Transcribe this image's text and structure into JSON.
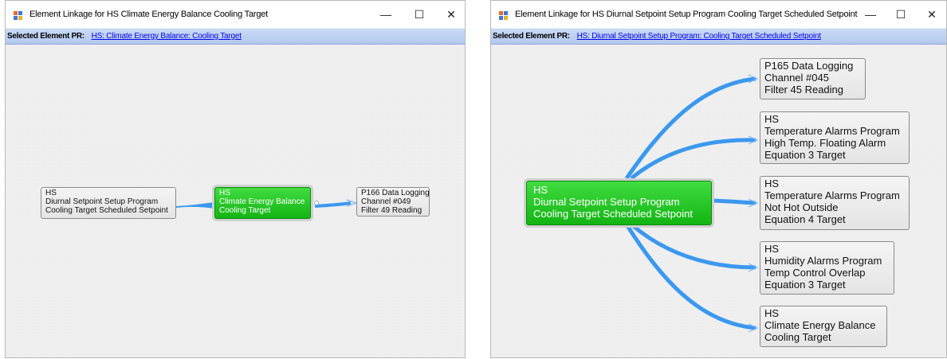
{
  "window1": {
    "title": "Element Linkage for HS Climate Energy Balance Cooling Target",
    "selected_label": "Selected Element PR:",
    "selected_link": "HS: Climate Energy Balance: Cooling Target",
    "controls": {
      "minimize": "—",
      "maximize": "☐",
      "close": "✕"
    },
    "nodes": {
      "source": [
        "HS",
        "Diurnal Setpoint Setup Program",
        "Cooling Target Scheduled Setpoint"
      ],
      "selected": [
        "HS",
        "Climate Energy Balance",
        "Cooling Target"
      ],
      "target": [
        "P166 Data Logging",
        "Channel #049",
        "Filter 49 Reading"
      ]
    }
  },
  "window2": {
    "title": "Element Linkage for HS Diurnal Setpoint Setup Program Cooling Target Scheduled Setpoint",
    "selected_label": "Selected Element PR:",
    "selected_link": "HS: Diurnal Setpoint Setup Program: Cooling Target Scheduled Setpoint",
    "controls": {
      "minimize": "—",
      "maximize": "☐",
      "close": "✕"
    },
    "nodes": {
      "selected": [
        "HS",
        "Diurnal Setpoint Setup Program",
        "Cooling Target Scheduled Setpoint"
      ],
      "targets": [
        [
          "P165 Data Logging",
          "Channel #045",
          "Filter 45 Reading"
        ],
        [
          "HS",
          "Temperature Alarms Program",
          "High Temp. Floating Alarm",
          "Equation 3 Target"
        ],
        [
          "HS",
          "Temperature Alarms Program",
          "Not Hot Outside",
          "Equation 4 Target"
        ],
        [
          "HS",
          "Humidity Alarms Program",
          "Temp Control Overlap",
          "Equation 3 Target"
        ],
        [
          "HS",
          "Climate Energy Balance",
          "Cooling Target"
        ]
      ]
    }
  },
  "colors": {
    "selected_node": "#22c322",
    "edge": "#3b98ef",
    "title_bar": "#ffffff",
    "selection_bar": "#bcd0f2"
  }
}
